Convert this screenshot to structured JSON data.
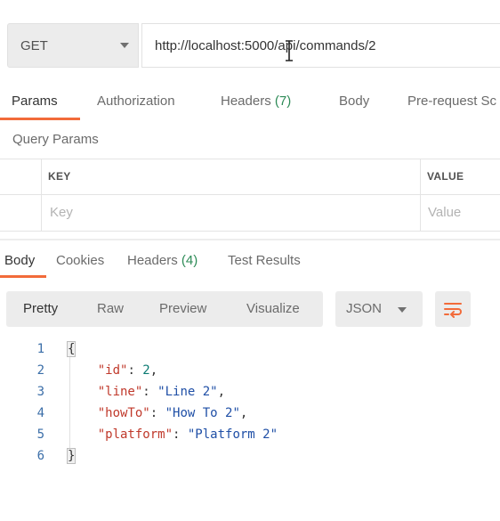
{
  "request": {
    "method": "GET",
    "url": "http://localhost:5000/api/commands/2"
  },
  "request_tabs": {
    "params": "Params",
    "authorization": "Authorization",
    "headers": "Headers",
    "headers_count": "(7)",
    "body": "Body",
    "prerequest": "Pre-request Sc"
  },
  "query_params": {
    "title": "Query Params",
    "columns": {
      "key": "KEY",
      "value": "VALUE"
    },
    "placeholders": {
      "key": "Key",
      "value": "Value"
    }
  },
  "response_tabs": {
    "body": "Body",
    "cookies": "Cookies",
    "headers": "Headers",
    "headers_count": "(4)",
    "test_results": "Test Results"
  },
  "format_toolbar": {
    "pretty": "Pretty",
    "raw": "Raw",
    "preview": "Preview",
    "visualize": "Visualize",
    "language": "JSON"
  },
  "response_body": {
    "line_numbers": [
      "1",
      "2",
      "3",
      "4",
      "5",
      "6"
    ],
    "open_brace": "{",
    "close_brace": "}",
    "fields": [
      {
        "key": "\"id\"",
        "value": "2",
        "value_type": "number",
        "trailing": ","
      },
      {
        "key": "\"line\"",
        "value": "\"Line 2\"",
        "value_type": "string",
        "trailing": ","
      },
      {
        "key": "\"howTo\"",
        "value": "\"How To 2\"",
        "value_type": "string",
        "trailing": ","
      },
      {
        "key": "\"platform\"",
        "value": "\"Platform 2\"",
        "value_type": "string",
        "trailing": ""
      }
    ]
  },
  "colors": {
    "accent": "#f26b3a",
    "count_green": "#2e8b57",
    "json_key": "#c0392b",
    "json_string": "#1f4fa6",
    "json_number": "#0b7a72",
    "line_number": "#3b6ea8"
  }
}
